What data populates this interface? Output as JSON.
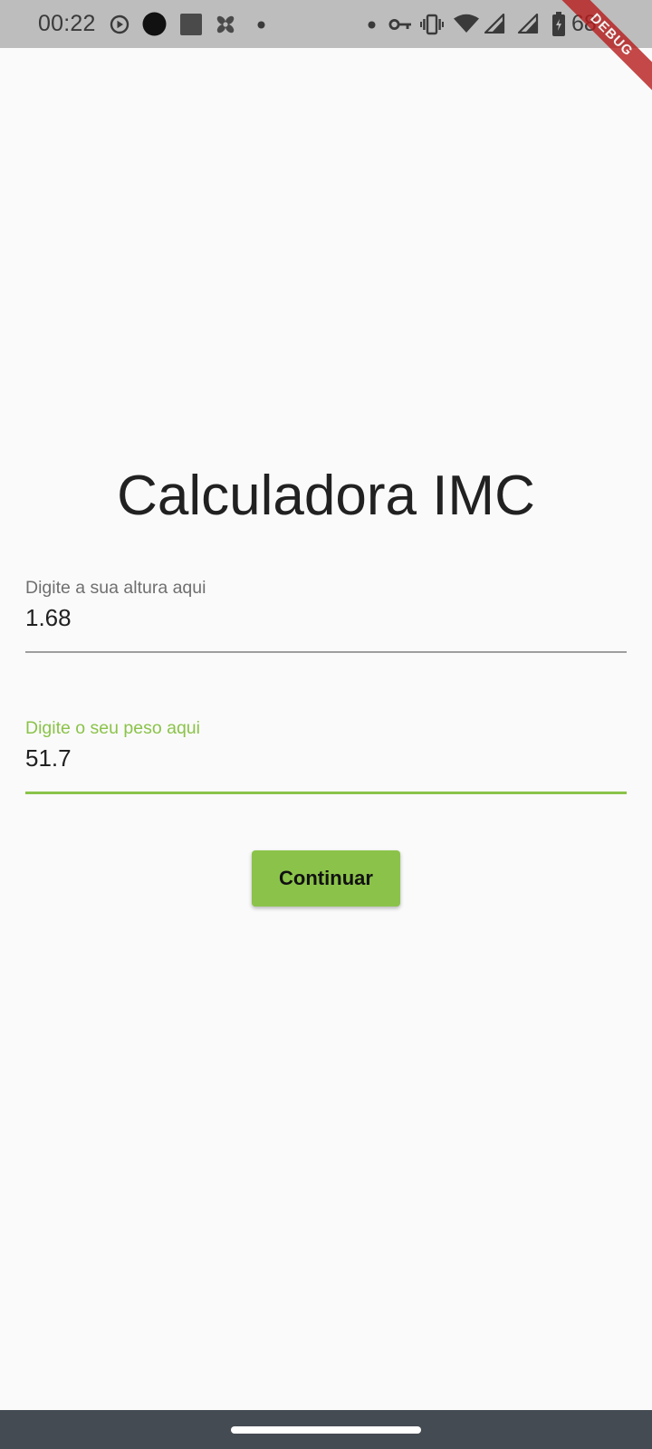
{
  "status_bar": {
    "time": "00:22",
    "battery_text": "68",
    "left_icons": [
      "play-circle-icon",
      "record-dot-icon",
      "square-icon",
      "fan-icon",
      "small-dot-icon"
    ],
    "right_icons": [
      "small-dot-icon",
      "vpn-key-icon",
      "vibrate-icon",
      "wifi-icon",
      "cell-signal-icon",
      "cell-signal-icon",
      "battery-icon"
    ]
  },
  "debug_banner": {
    "label": "DEBUG"
  },
  "app": {
    "title": "Calculadora IMC",
    "height_field": {
      "label": "Digite a sua altura aqui",
      "value": "1.68"
    },
    "weight_field": {
      "label": "Digite o seu peso aqui",
      "value": "51.7",
      "focused": true
    },
    "continue_label": "Continuar"
  },
  "colors": {
    "accent": "#8bc34a",
    "background": "#fafafa",
    "status_bar": "#bdbdbd",
    "nav_bar": "#454b53",
    "debug_ribbon": "#b71c1c"
  }
}
